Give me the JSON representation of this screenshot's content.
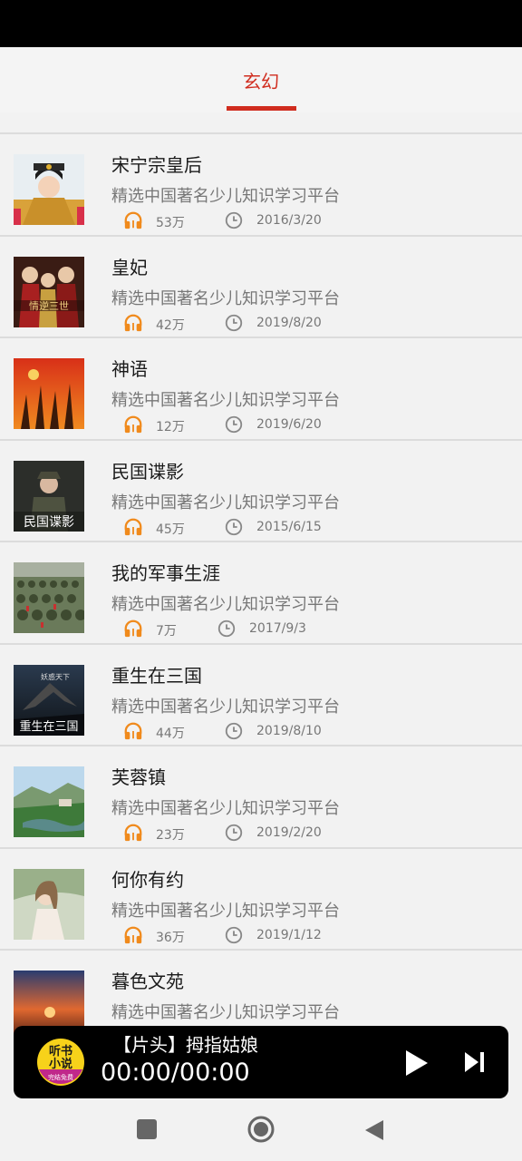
{
  "header": {
    "tab_label": "玄幻"
  },
  "list": {
    "items": [
      {
        "title": "宋宁宗皇后",
        "desc": "精选中国著名少儿知识学习平台",
        "plays": "53万",
        "date": "2016/3/20"
      },
      {
        "title": "皇妃",
        "desc": "精选中国著名少儿知识学习平台",
        "plays": "42万",
        "date": "2019/8/20"
      },
      {
        "title": "神语",
        "desc": "精选中国著名少儿知识学习平台",
        "plays": "12万",
        "date": "2019/6/20"
      },
      {
        "title": "民国谍影",
        "desc": "精选中国著名少儿知识学习平台",
        "plays": "45万",
        "date": "2015/6/15"
      },
      {
        "title": "我的军事生涯",
        "desc": "精选中国著名少儿知识学习平台",
        "plays": "7万",
        "date": "2017/9/3"
      },
      {
        "title": "重生在三国",
        "desc": "精选中国著名少儿知识学习平台",
        "plays": "44万",
        "date": "2019/8/10"
      },
      {
        "title": "芙蓉镇",
        "desc": "精选中国著名少儿知识学习平台",
        "plays": "23万",
        "date": "2019/2/20"
      },
      {
        "title": "何你有约",
        "desc": "精选中国著名少儿知识学习平台",
        "plays": "36万",
        "date": "2019/1/12"
      },
      {
        "title": "暮色文苑",
        "desc": "精选中国著名少儿知识学习平台"
      }
    ]
  },
  "cover_text": {
    "item2": "情逆三世",
    "item4": "民国谍影",
    "item6_top": "妖惑天下",
    "item6_bottom": "重生在三国"
  },
  "player": {
    "title": "【片头】拇指姑娘",
    "time": "00:00/00:00",
    "logo_line1": "听书",
    "logo_line2": "小说",
    "logo_line3": "完结免费"
  },
  "colors": {
    "accent": "#d02c1e",
    "icon_orange": "#f08a1c",
    "text_gray": "#777777"
  },
  "icons": {
    "plays": "headphones-icon",
    "date": "clock-icon"
  }
}
